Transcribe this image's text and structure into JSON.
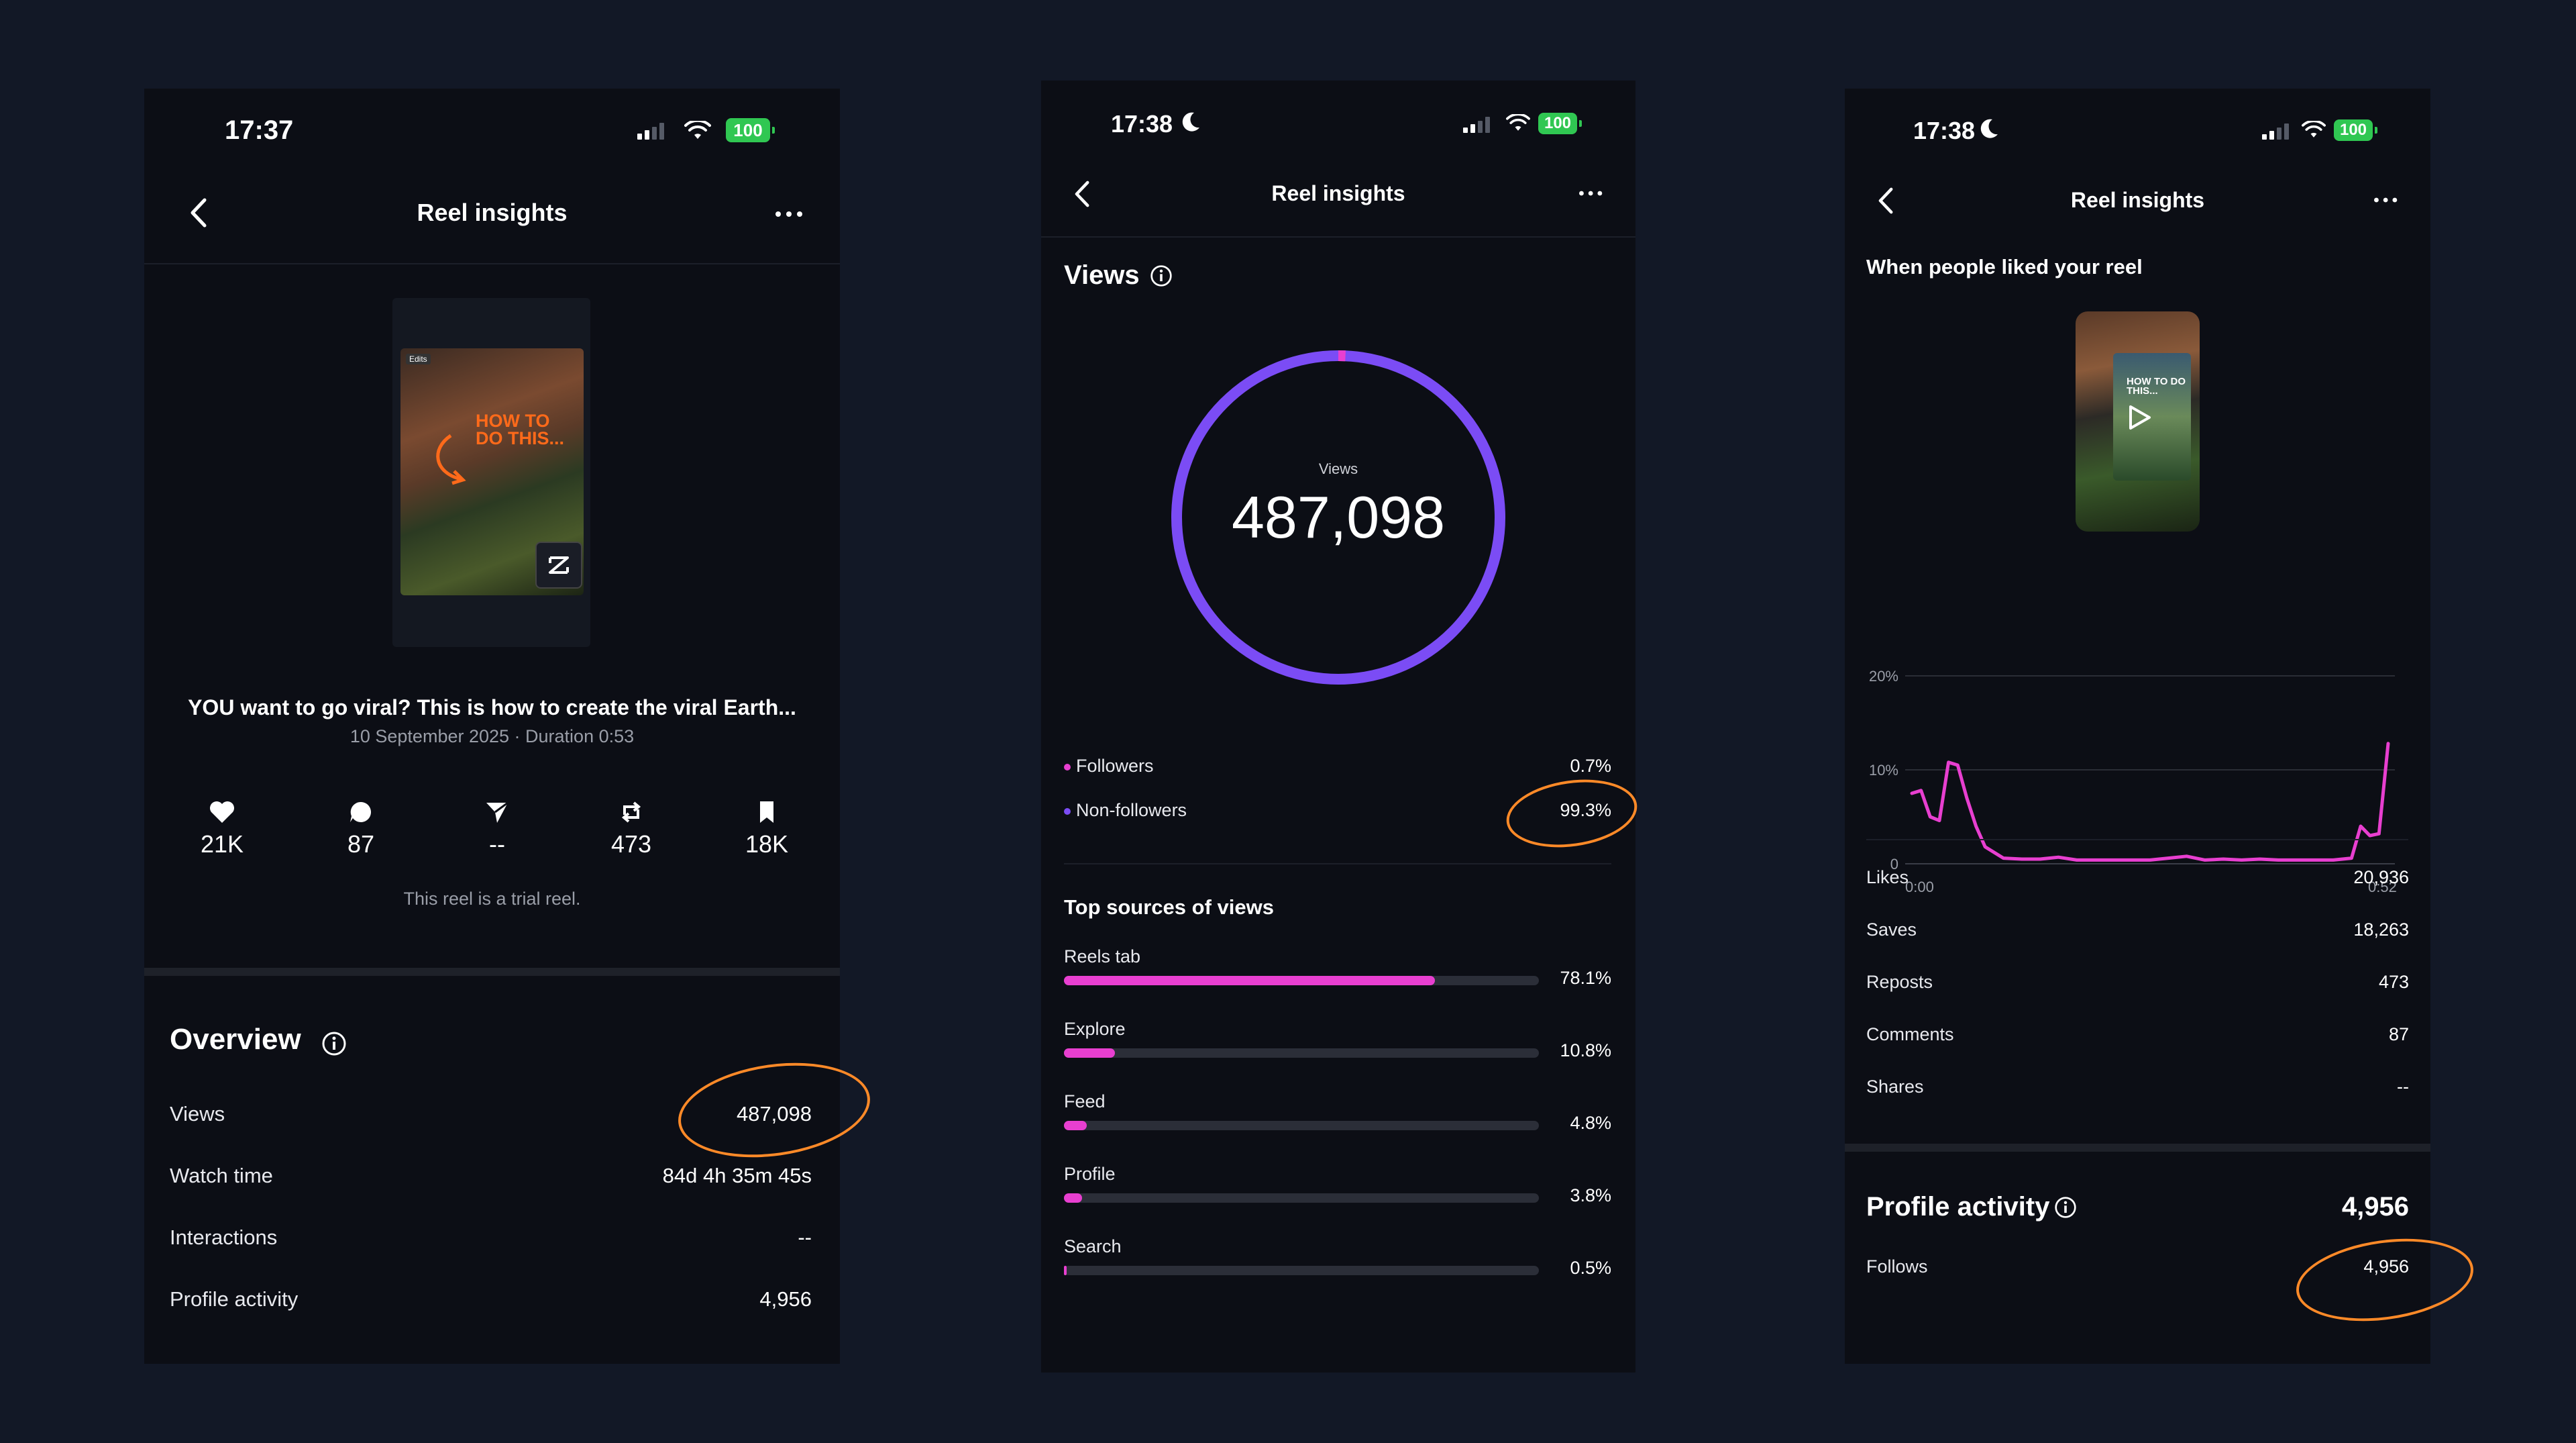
{
  "phones": [
    {
      "status": {
        "time": "17:37",
        "battery": "100"
      },
      "header": {
        "title": "Reel insights"
      },
      "thumbnail": {
        "badge": "Edits",
        "overlay_text": "HOW TO DO THIS..."
      },
      "reel": {
        "caption": "YOU want to go viral? This is how to create the viral Earth...",
        "meta": "10 September 2025 · Duration 0:53"
      },
      "stats": [
        {
          "icon": "heart-icon",
          "value": "21K"
        },
        {
          "icon": "comment-icon",
          "value": "87"
        },
        {
          "icon": "share-icon",
          "value": "--"
        },
        {
          "icon": "repost-icon",
          "value": "473"
        },
        {
          "icon": "bookmark-icon",
          "value": "18K"
        }
      ],
      "trial_note": "This reel is a trial reel.",
      "overview": {
        "title": "Overview",
        "rows": [
          {
            "label": "Views",
            "value": "487,098"
          },
          {
            "label": "Watch time",
            "value": "84d 4h 35m 45s"
          },
          {
            "label": "Interactions",
            "value": "--"
          },
          {
            "label": "Profile activity",
            "value": "4,956"
          }
        ]
      }
    },
    {
      "status": {
        "time": "17:38",
        "battery": "100"
      },
      "header": {
        "title": "Reel insights"
      },
      "views": {
        "title": "Views",
        "center_label": "Views",
        "center_value": "487,098",
        "split": [
          {
            "label": "Followers",
            "value": "0.7%",
            "fraction": 0.007,
            "color": "#e83fd0"
          },
          {
            "label": "Non-followers",
            "value": "99.3%",
            "fraction": 0.993,
            "color": "#7b4cf5"
          }
        ]
      },
      "sources": {
        "title": "Top sources of views",
        "items": [
          {
            "label": "Reels tab",
            "value": "78.1%",
            "fraction": 0.781
          },
          {
            "label": "Explore",
            "value": "10.8%",
            "fraction": 0.108
          },
          {
            "label": "Feed",
            "value": "4.8%",
            "fraction": 0.048
          },
          {
            "label": "Profile",
            "value": "3.8%",
            "fraction": 0.038
          },
          {
            "label": "Search",
            "value": "0.5%",
            "fraction": 0.005
          }
        ]
      }
    },
    {
      "status": {
        "time": "17:38",
        "battery": "100"
      },
      "header": {
        "title": "Reel insights"
      },
      "likes_chart": {
        "title": "When people liked your reel",
        "thumb_text": "HOW TO DO THIS..."
      },
      "metrics": [
        {
          "label": "Likes",
          "value": "20,936"
        },
        {
          "label": "Saves",
          "value": "18,263"
        },
        {
          "label": "Reposts",
          "value": "473"
        },
        {
          "label": "Comments",
          "value": "87"
        },
        {
          "label": "Shares",
          "value": "--"
        }
      ],
      "profile_activity": {
        "title": "Profile activity",
        "total": "4,956",
        "rows": [
          {
            "label": "Follows",
            "value": "4,956"
          }
        ]
      }
    }
  ],
  "chart_data": {
    "type": "line",
    "title": "When people liked your reel",
    "xlabel": "",
    "ylabel": "",
    "x_ticks": [
      "0:00",
      "0:52"
    ],
    "y_ticks": [
      "0",
      "10%",
      "20%"
    ],
    "ylim": [
      0,
      20
    ],
    "x": [
      0,
      1,
      2,
      3,
      4,
      5,
      6,
      7,
      8,
      10,
      12,
      14,
      16,
      18,
      20,
      22,
      24,
      26,
      28,
      30,
      32,
      34,
      36,
      38,
      40,
      42,
      44,
      46,
      48,
      49,
      50,
      51,
      52
    ],
    "series": [
      {
        "values": [
          7.5,
          7.8,
          5.0,
          4.6,
          10.8,
          10.5,
          7.0,
          4.0,
          1.8,
          0.6,
          0.5,
          0.5,
          0.7,
          0.4,
          0.4,
          0.4,
          0.4,
          0.4,
          0.6,
          0.8,
          0.4,
          0.5,
          0.4,
          0.5,
          0.4,
          0.4,
          0.4,
          0.4,
          0.6,
          4.0,
          3.0,
          3.2,
          12.8
        ],
        "color": "#e83fd0"
      }
    ]
  }
}
